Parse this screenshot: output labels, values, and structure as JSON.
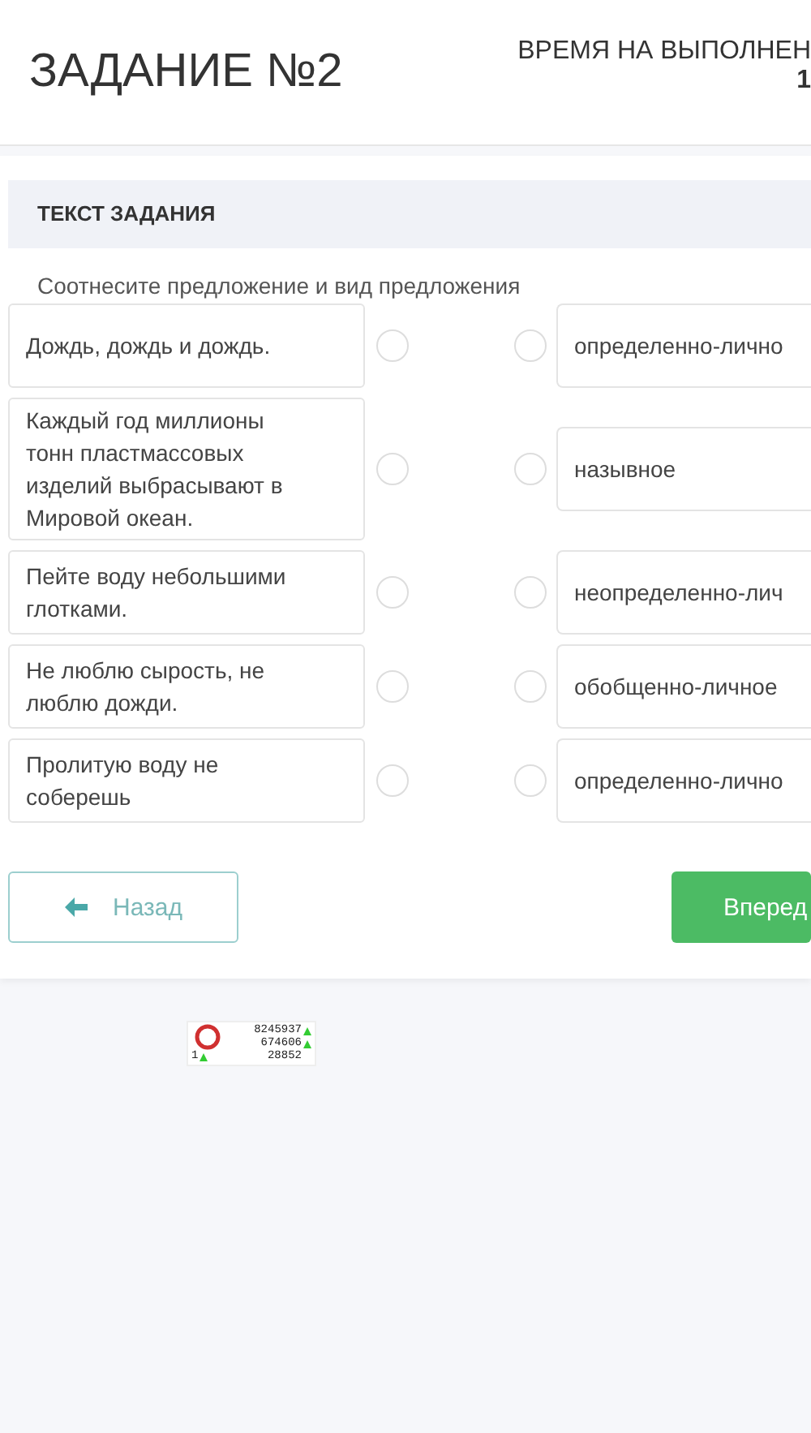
{
  "header": {
    "title": "ЗАДАНИЕ №2",
    "timer_label": "ВРЕМЯ НА ВЫПОЛНЕН",
    "timer_value": "1"
  },
  "task": {
    "heading": "ТЕКСТ ЗАДАНИЯ",
    "instruction": "Соотнесите предложение и вид предложения"
  },
  "pairs": [
    {
      "sentence": "Дождь, дождь и дождь.",
      "left_selected": false,
      "option": "определенно-лично",
      "right_selected": false
    },
    {
      "sentence": "Каждый год миллионы тонн пластмассовых изделий выбрасывают в Мировой океан.",
      "left_selected": false,
      "option": "назывное",
      "right_selected": false
    },
    {
      "sentence": "Пейте воду небольшими глотками.",
      "left_selected": false,
      "option": "неопределенно-лич",
      "right_selected": false
    },
    {
      "sentence": "Не люблю сырость, не люблю дожди.",
      "left_selected": false,
      "option": "обобщенно-личное",
      "right_selected": false
    },
    {
      "sentence": "Пролитую воду не соберешь",
      "left_selected": false,
      "option": "определенно-лично",
      "right_selected": false
    }
  ],
  "buttons": [
    {
      "label": "Назад",
      "kind": "back"
    },
    {
      "label": "Вперед",
      "kind": "next"
    }
  ],
  "counter": {
    "values": [
      "8245937",
      "674606",
      "28852"
    ],
    "left_value": "1"
  }
}
